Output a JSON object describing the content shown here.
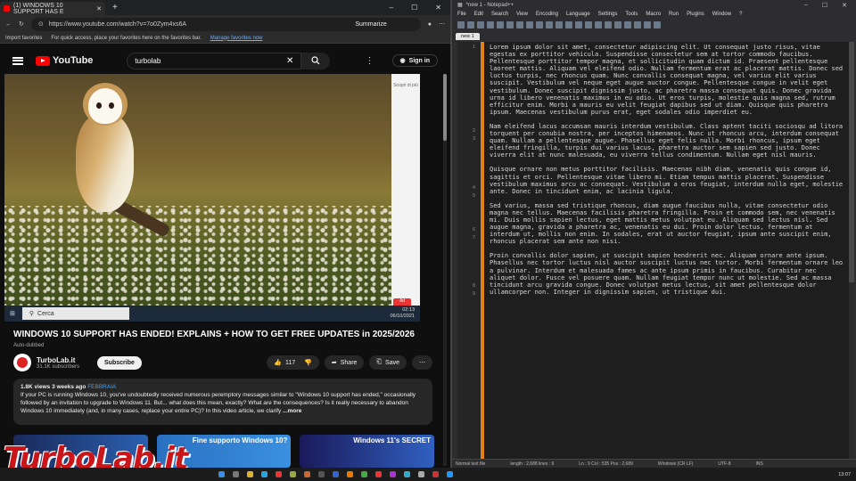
{
  "browser": {
    "tab_title": "(1) WINDOWS 10 SUPPORT HAS E",
    "url": "https://www.youtube.com/watch?v=7o0Zym4xs6A",
    "summarize_label": "Summarize",
    "favorites_import": "Import favorites",
    "favorites_hint": "For quick access, place your favorites here on the favorites bar.",
    "favorites_manage": "Manage favorites now"
  },
  "youtube": {
    "logo_text": "YouTube",
    "search_value": "turbolab",
    "signin_label": "Sign in",
    "video": {
      "ad_text": "Scopri di più",
      "taskbar_search": "Cerca",
      "clock_time": "02:13",
      "clock_date": "06/10/2021",
      "ad_badge": "Ad"
    },
    "title": "WINDOWS 10 SUPPORT HAS ENDED! EXPLAINS + HOW TO GET FREE UPDATES in 2025/2026",
    "auto_dubbed": "Auto-dubbed",
    "channel_name": "TurboLab.it",
    "subscribers": "31.1K subscribers",
    "subscribe_label": "Subscribe",
    "likes": "117",
    "share_label": "Share",
    "save_label": "Save",
    "views": "1.8K views",
    "ago": "3 weeks ago",
    "hashtag": "FEBBRAIA",
    "description": "If your PC is running Windows 10, you've undoubtedly received numerous peremptory messages similar to \"Windows 10 support has ended,\" occasionally followed by an invitation to upgrade to Windows 11. But... what does this mean, exactly? What are the consequences? Is it really necessary to abandon Windows 10 immediately (and, in many cases, replace your entire PC)? In this video article, we clarify",
    "more_label": "...more",
    "thumbnails": [
      {
        "caption": ""
      },
      {
        "caption": "Fine supporto Windows 10?"
      },
      {
        "caption": "Windows 11's SECRET"
      }
    ],
    "watermark": "TurboLab.it"
  },
  "notepad": {
    "title": "*new 1 - Notepad++",
    "menu": [
      "File",
      "Edit",
      "Search",
      "View",
      "Encoding",
      "Language",
      "Settings",
      "Tools",
      "Macro",
      "Run",
      "Plugins",
      "Window",
      "?"
    ],
    "tab_label": "new 1",
    "line_numbers": [
      "1",
      "2",
      "3",
      "4",
      "5",
      "6",
      "7",
      "8",
      "9"
    ],
    "paragraphs": [
      "Lorem ipsum dolor sit amet, consectetur adipiscing elit. Ut consequat justo risus, vitae egestas ex porttitor vehicula. Suspendisse consectetur sem at tortor commodo faucibus. Pellentesque porttitor tempor magna, et sollicitudin quam dictum id. Praesent pellentesque laoreet mattis. Aliquam vel eleifend odio. Nullam fermentum erat ac placerat mattis. Donec sed luctus turpis, nec rhoncus quam. Nunc convallis consequat magna, vel varius elit varius suscipit. Vestibulum vel neque eget augue auctor congue. Pellentesque congue in velit eget vestibulum. Donec suscipit dignissim justo, ac pharetra massa consequat quis. Donec gravida urna id libero venenatis maximus in eu odio. Ut eros turpis, molestie quis magna sed, rutrum efficitur enim. Morbi a mauris eu velit feugiat dapibus sed ut diam. Quisque quis pharetra ipsum. Maecenas vestibulum purus erat, eget sodales odio imperdiet eu.",
      "Nam eleifend lacus accumsan mauris interdum vestibulum. Class aptent taciti sociosqu ad litora torquent per conubia nostra, per inceptos himenaeos. Nunc ut rhoncus arcu, interdum consequat quam. Nullam a pellentesque augue. Phasellus eget felis nulla. Morbi rhoncus, ipsum eget eleifend fringilla, turpis dui varius lacus, pharetra auctor sem sapien sed justo. Donec viverra elit at nunc malesuada, eu viverra tellus condimentum. Nullam eget nisl mauris.",
      "Quisque ornare non metus porttitor facilisis. Maecenas nibh diam, venenatis quis congue id, sagittis et orci. Pellentesque vitae libero mi. Etiam tempus mattis placerat. Suspendisse vestibulum maximus arcu ac consequat. Vestibulum a eros feugiat, interdum nulla eget, molestie ante. Donec in tincidunt enim, ac lacinia ligula.",
      "Sed varius, massa sed tristique rhoncus, diam augue faucibus nulla, vitae consectetur odio magna nec tellus. Maecenas facilisis pharetra fringilla. Proin et commodo sem, nec venenatis mi. Duis mollis sapien lectus, eget mattis metus volutpat eu. Aliquam sed lectus nisl. Sed augue magna, gravida a pharetra ac, venenatis eu dui. Proin dolor lectus, fermentum at interdum ut, mollis non enim. In sodales, erat ut auctor feugiat, ipsum ante suscipit enim, rhoncus placerat sem ante non nisi.",
      "Proin convallis dolor sapien, ut suscipit sapien hendrerit nec. Aliquam ornare ante ipsum. Phasellus nec tortor luctus nisl auctor suscipit luctus nec tortor. Morbi fermentum ornare leo a pulvinar. Interdum et malesuada fames ac ante ipsum primis in faucibus. Curabitur nec aliquet dolor. Fusce vel posuere quam. Nullam feugiat tempor nunc ut molestie. Sed ac massa tincidunt arcu gravida congue. Donec volutpat metus lectus, sit amet pellentesque dolor ullamcorper non. Integer in dignissim sapien, ut tristique dui."
    ],
    "status": {
      "type": "Normal text file",
      "length": "length : 2,688   lines : 9",
      "position": "Ln : 9    Col : 535    Pos : 2,689",
      "eol": "Windows (CR LF)",
      "encoding": "UTF-8",
      "mode": "INS"
    }
  },
  "taskbar": {
    "time": "13:07",
    "date": ""
  }
}
